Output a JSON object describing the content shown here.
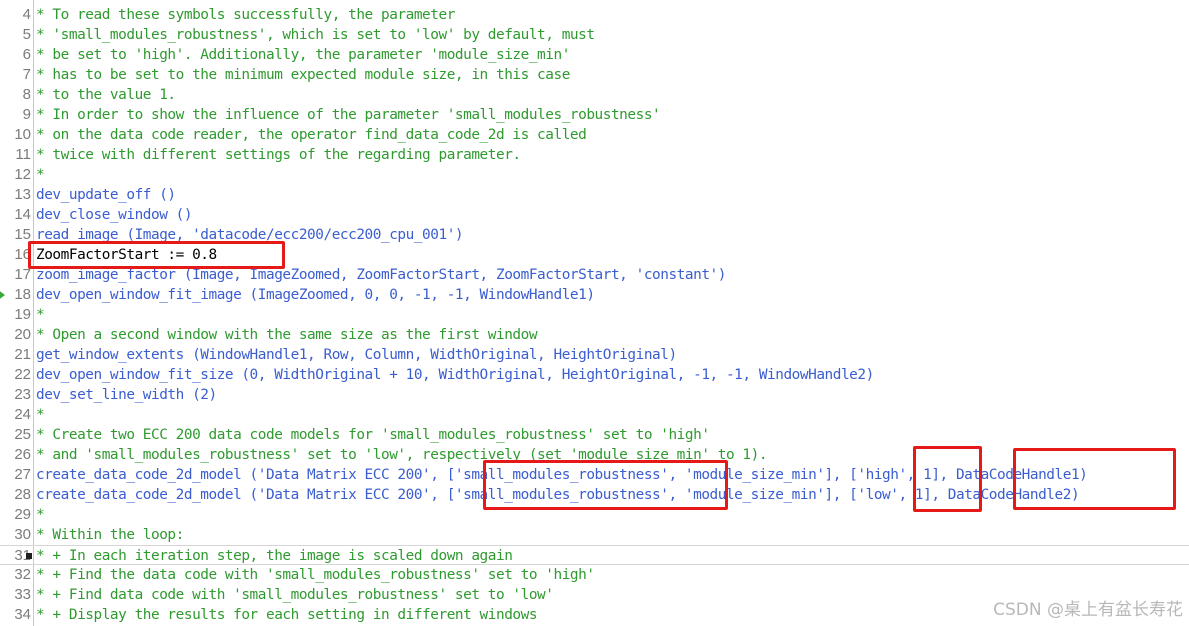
{
  "editor": {
    "lines": [
      {
        "n": "4",
        "cls": "comment",
        "text": "* To read these symbols successfully, the parameter"
      },
      {
        "n": "5",
        "cls": "comment",
        "text": "* 'small_modules_robustness', which is set to 'low' by default, must"
      },
      {
        "n": "6",
        "cls": "comment",
        "text": "* be set to 'high'. Additionally, the parameter 'module_size_min'"
      },
      {
        "n": "7",
        "cls": "comment",
        "text": "* has to be set to the minimum expected module size, in this case"
      },
      {
        "n": "8",
        "cls": "comment",
        "text": "* to the value 1."
      },
      {
        "n": "9",
        "cls": "comment",
        "text": "* In order to show the influence of the parameter 'small_modules_robustness'"
      },
      {
        "n": "10",
        "cls": "comment",
        "text": "* on the data code reader, the operator find_data_code_2d is called"
      },
      {
        "n": "11",
        "cls": "comment",
        "text": "* twice with different settings of the regarding parameter."
      },
      {
        "n": "12",
        "cls": "comment",
        "text": "*"
      },
      {
        "n": "13",
        "cls": "op",
        "text": "dev_update_off ()"
      },
      {
        "n": "14",
        "cls": "op",
        "text": "dev_close_window ()"
      },
      {
        "n": "15",
        "cls": "op",
        "text": "read_image (Image, 'datacode/ecc200/ecc200_cpu_001')"
      },
      {
        "n": "16",
        "cls": "var",
        "text": "ZoomFactorStart := 0.8"
      },
      {
        "n": "17",
        "cls": "op",
        "text": "zoom_image_factor (Image, ImageZoomed, ZoomFactorStart, ZoomFactorStart, 'constant')"
      },
      {
        "n": "18",
        "cls": "op",
        "text": "dev_open_window_fit_image (ImageZoomed, 0, 0, -1, -1, WindowHandle1)"
      },
      {
        "n": "19",
        "cls": "comment",
        "text": "*"
      },
      {
        "n": "20",
        "cls": "comment",
        "text": "* Open a second window with the same size as the first window"
      },
      {
        "n": "21",
        "cls": "op",
        "text": "get_window_extents (WindowHandle1, Row, Column, WidthOriginal, HeightOriginal)"
      },
      {
        "n": "22",
        "cls": "op",
        "text": "dev_open_window_fit_size (0, WidthOriginal + 10, WidthOriginal, HeightOriginal, -1, -1, WindowHandle2)"
      },
      {
        "n": "23",
        "cls": "op",
        "text": "dev_set_line_width (2)"
      },
      {
        "n": "24",
        "cls": "comment",
        "text": "*"
      },
      {
        "n": "25",
        "cls": "comment",
        "text": "* Create two ECC 200 data code models for 'small_modules_robustness' set to 'high'"
      },
      {
        "n": "26",
        "cls": "comment",
        "text": "* and 'small_modules_robustness' set to 'low', respectively (set 'module_size_min' to 1)."
      },
      {
        "n": "27",
        "cls": "op",
        "text": "create_data_code_2d_model ('Data Matrix ECC 200', ['small_modules_robustness', 'module_size_min'], ['high', 1], DataCodeHandle1)"
      },
      {
        "n": "28",
        "cls": "op",
        "text": "create_data_code_2d_model ('Data Matrix ECC 200', ['small_modules_robustness', 'module_size_min'], ['low', 1], DataCodeHandle2)"
      },
      {
        "n": "29",
        "cls": "comment",
        "text": "*"
      },
      {
        "n": "30",
        "cls": "comment",
        "text": "* Within the loop:"
      },
      {
        "n": "31",
        "cls": "comment",
        "text": "* + In each iteration step, the image is scaled down again"
      },
      {
        "n": "32",
        "cls": "comment",
        "text": "* + Find the data code with 'small_modules_robustness' set to 'high'"
      },
      {
        "n": "33",
        "cls": "comment",
        "text": "* + Find data code with 'small_modules_robustness' set to 'low'"
      },
      {
        "n": "34",
        "cls": "comment",
        "text": "* + Display the results for each setting in different windows"
      }
    ]
  },
  "watermark": "CSDN @桌上有盆长寿花",
  "colors": {
    "comment": "#2f9a2f",
    "operator": "#3a5dd0",
    "highlight_box": "#e61919",
    "line_number": "#7b7b7b"
  },
  "icons": [
    "execution-arrow-icon",
    "cursor-marker-icon"
  ]
}
